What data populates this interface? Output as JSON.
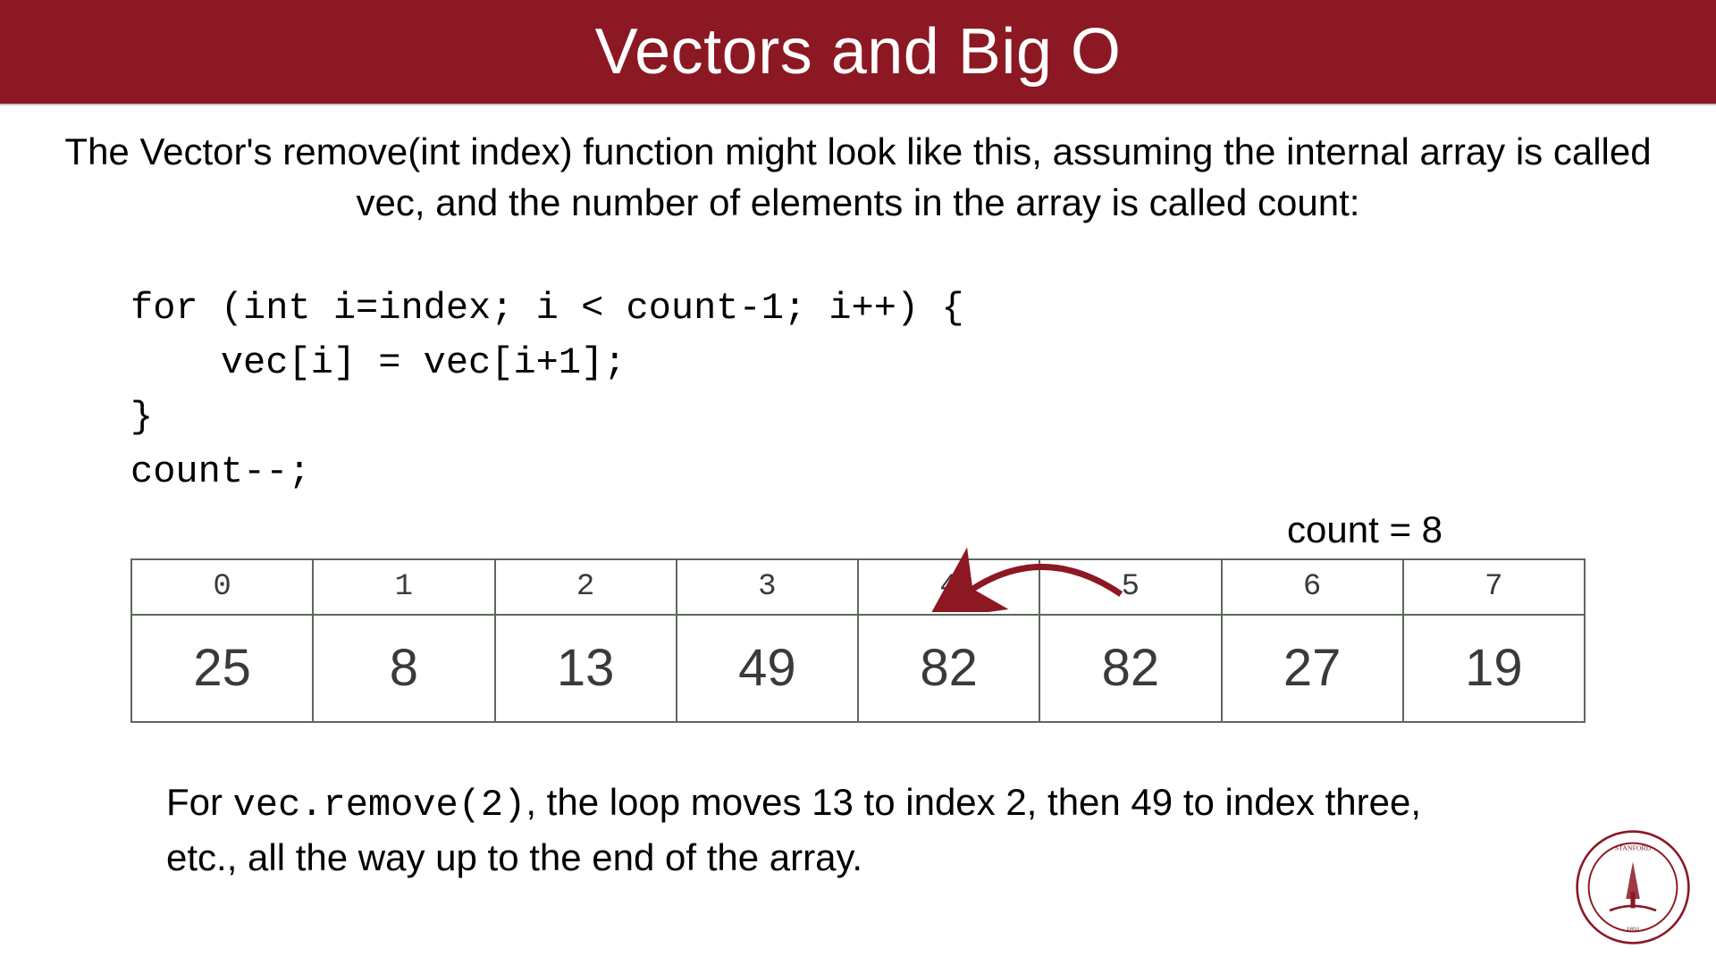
{
  "header": {
    "title": "Vectors and Big O"
  },
  "intro": "The Vector's remove(int index) function might look like this, assuming the internal array is called vec, and the number of elements in the array is called count:",
  "code": "for (int i=index; i < count-1; i++) {\n    vec[i] = vec[i+1];\n}\ncount--;",
  "count_label": "count = 8",
  "array": {
    "indices": [
      "0",
      "1",
      "2",
      "3",
      "4",
      "5",
      "6",
      "7"
    ],
    "values": [
      "25",
      "8",
      "13",
      "49",
      "82",
      "82",
      "27",
      "19"
    ]
  },
  "explain": {
    "prefix": "For ",
    "mono": "vec.remove(2)",
    "suffix": ", the loop moves 13 to index 2, then 49 to index three, etc., all the way up to the end of the array."
  },
  "seal_alt": "Stanford University seal"
}
